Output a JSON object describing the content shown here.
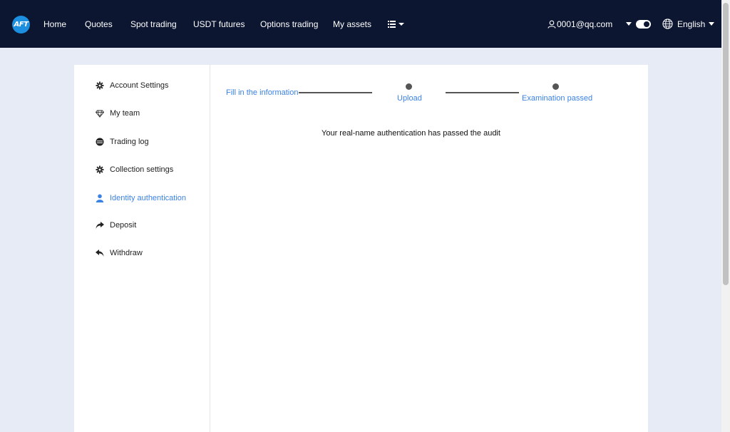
{
  "header": {
    "logo_text": "AFT",
    "nav": [
      "Home",
      "Quotes",
      "Spot trading",
      "USDT futures",
      "Options trading",
      "My assets"
    ],
    "user": "0001@qq.com",
    "language": "English"
  },
  "sidebar": {
    "items": [
      {
        "label": "Account Settings",
        "icon": "gear-icon"
      },
      {
        "label": "My team",
        "icon": "diamond-icon"
      },
      {
        "label": "Trading log",
        "icon": "log-icon"
      },
      {
        "label": "Collection settings",
        "icon": "gear-icon"
      },
      {
        "label": "Identity authentication",
        "icon": "user-icon"
      },
      {
        "label": "Deposit",
        "icon": "share-arrow-icon"
      },
      {
        "label": "Withdraw",
        "icon": "reply-arrow-icon"
      }
    ],
    "active_index": 4
  },
  "steps": [
    "Fill in the information",
    "Upload",
    "Examination passed"
  ],
  "message": "Your real-name authentication has passed the audit",
  "colors": {
    "header_bg": "#0c1631",
    "accent": "#3b82e6",
    "page_bg": "#e6ebf5"
  }
}
